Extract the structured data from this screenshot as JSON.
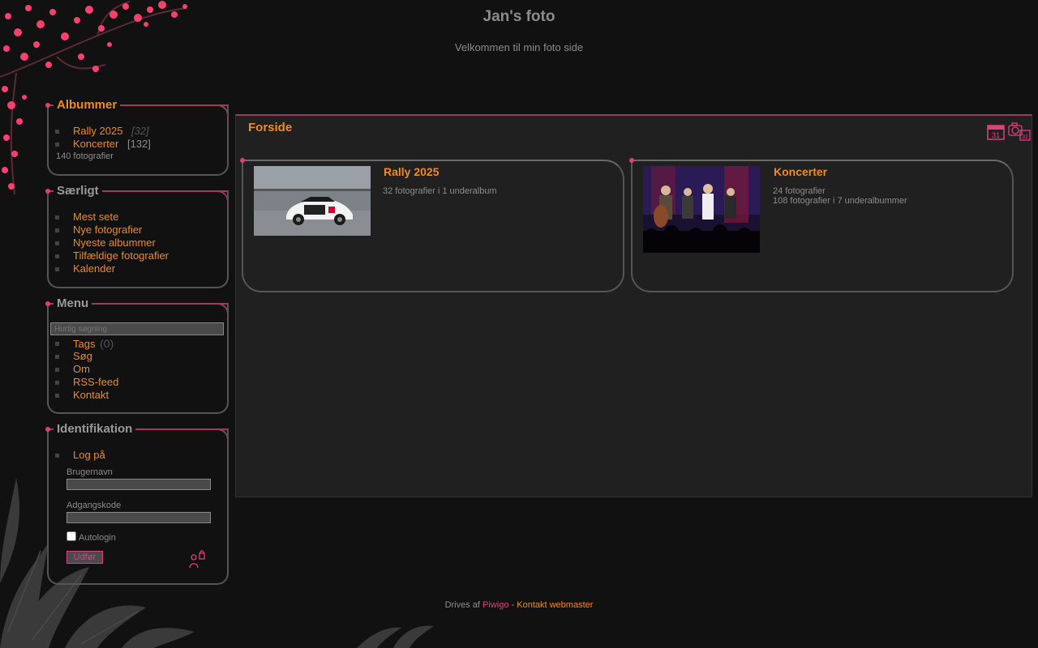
{
  "header": {
    "title": "Jan's foto",
    "subtitle": "Velkommen til min foto side"
  },
  "albums_box": {
    "title": "Albummer",
    "items": [
      {
        "label": "Rally 2025",
        "count": "[32]"
      },
      {
        "label": "Koncerter",
        "count": "[132]"
      }
    ],
    "total": "140 fotografier"
  },
  "special_box": {
    "title": "Særligt",
    "items": [
      "Mest sete",
      "Nye fotografier",
      "Nyeste albummer",
      "Tilfældige fotografier",
      "Kalender"
    ]
  },
  "menu_box": {
    "title": "Menu",
    "search_placeholder": "Hurtig søgning",
    "tags_label": "Tags",
    "tags_count": "(0)",
    "items": [
      "Søg",
      "Om",
      "RSS-feed",
      "Kontakt"
    ]
  },
  "ident_box": {
    "title": "Identifikation",
    "login_link": "Log på",
    "username_label": "Brugernavn",
    "password_label": "Adgangskode",
    "autologin_label": "Autologin",
    "submit_label": "Udfør"
  },
  "main": {
    "breadcrumb": "Forside",
    "albums": [
      {
        "title": "Rally 2025",
        "desc": [
          "32 fotografier i 1 underalbum"
        ]
      },
      {
        "title": "Koncerter",
        "desc": [
          "24 fotografier",
          "108 fotografier i 7 underalbummer"
        ]
      }
    ]
  },
  "footer": {
    "powered_prefix": "Drives af",
    "powered_link": "Piwigo",
    "separator": "-",
    "contact_link": "Kontakt webmaster"
  },
  "colors": {
    "accent_orange": "#f08a24",
    "accent_pink": "#e0407a",
    "background": "#111111",
    "panel": "#202020"
  }
}
